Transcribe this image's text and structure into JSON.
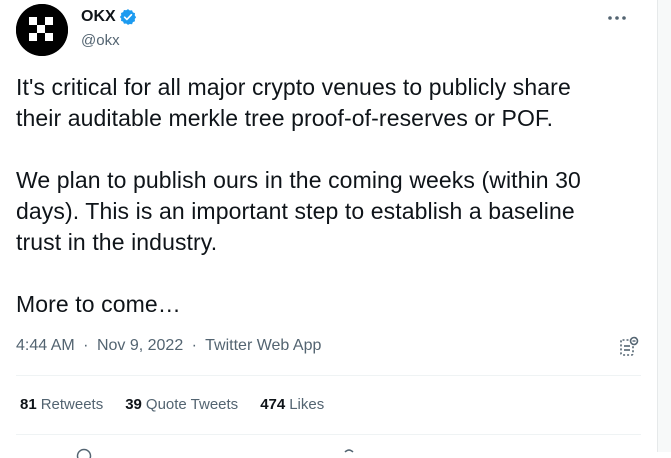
{
  "author": {
    "display_name": "OKX",
    "handle": "@okx",
    "verified": true,
    "verified_color": "#1d9bf0",
    "avatar_icon": "okx-logo-icon"
  },
  "menu": {
    "icon": "more-horizontal-icon"
  },
  "tweet": {
    "text": "It's critical for all major crypto venues to publicly share\ntheir auditable merkle tree proof-of-reserves or POF.\n\nWe plan to publish ours in the coming weeks (within 30\ndays). This is an important step to establish a baseline\ntrust in the industry.\n\nMore to come…",
    "time": "4:44 AM",
    "date": "Nov 9, 2022",
    "source": "Twitter Web App",
    "separator": "·"
  },
  "stats": {
    "retweets_count": "81",
    "retweets_label": "Retweets",
    "quotes_count": "39",
    "quotes_label": "Quote Tweets",
    "likes_count": "474",
    "likes_label": "Likes"
  },
  "colors": {
    "text_primary": "#0f1419",
    "text_secondary": "#536471",
    "divider": "#eff3f4"
  }
}
